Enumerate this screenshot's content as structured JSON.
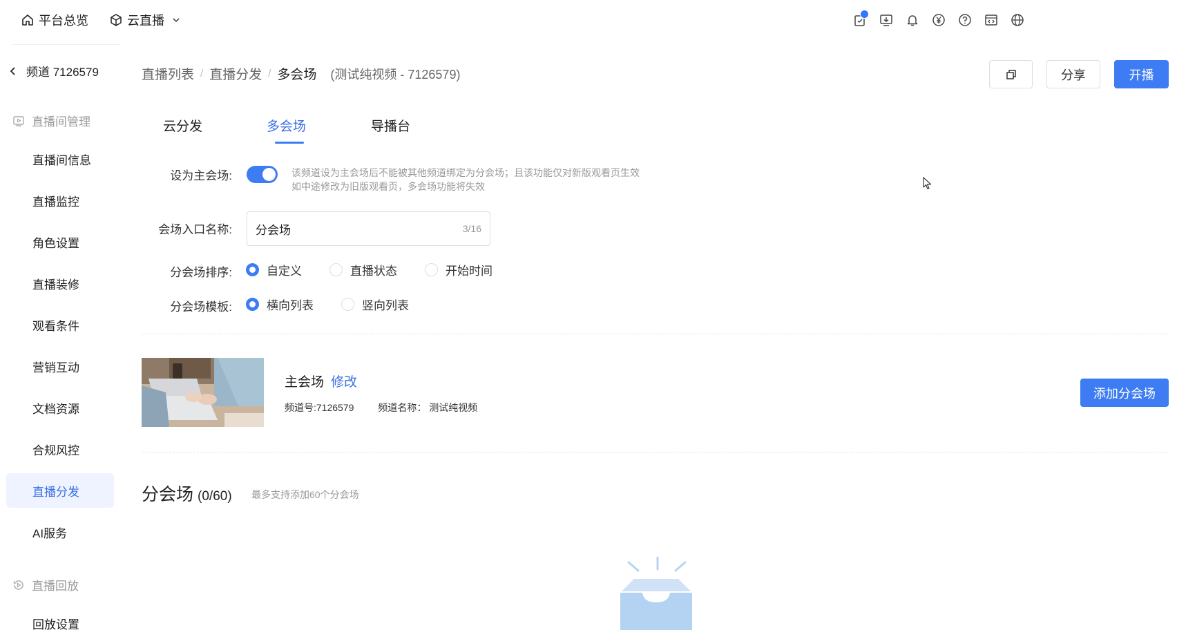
{
  "topbar": {
    "overview_label": "平台总览",
    "product_label": "云直播",
    "icons": [
      "task-check-icon",
      "download-icon",
      "bell-icon",
      "yuan-icon",
      "help-icon",
      "code-window-icon",
      "globe-icon"
    ]
  },
  "sidebar": {
    "channel_label": "频道 7126579",
    "group_room": "直播间管理",
    "items": [
      {
        "label": "直播间信息"
      },
      {
        "label": "直播监控"
      },
      {
        "label": "角色设置"
      },
      {
        "label": "直播装修"
      },
      {
        "label": "观看条件"
      },
      {
        "label": "营销互动"
      },
      {
        "label": "文档资源"
      },
      {
        "label": "合规风控"
      },
      {
        "label": "直播分发",
        "active": true
      },
      {
        "label": "AI服务"
      }
    ],
    "group_replay": "直播回放",
    "replay_items": [
      {
        "label": "回放设置"
      }
    ]
  },
  "header": {
    "breadcrumb": [
      "直播列表",
      "直播分发",
      "多会场"
    ],
    "separator": "/",
    "subtitle": "(测试纯视频 - 7126579)",
    "share_label": "分享",
    "start_label": "开播"
  },
  "tabs": [
    {
      "label": "云分发"
    },
    {
      "label": "多会场",
      "active": true
    },
    {
      "label": "导播台"
    }
  ],
  "form": {
    "main_venue_label": "设为主会场:",
    "main_venue_on": true,
    "hint_line1": "该频道设为主会场后不能被其他频道绑定为分会场；且该功能仅对新版观看页生效",
    "hint_line2": "如中途修改为旧版观看页，多会场功能将失效",
    "entry_name_label": "会场入口名称:",
    "entry_name_value": "分会场",
    "entry_name_count": "3/16",
    "sort_label": "分会场排序:",
    "sort_options": [
      "自定义",
      "直播状态",
      "开始时间"
    ],
    "sort_selected": "自定义",
    "template_label": "分会场模板:",
    "template_options": [
      "横向列表",
      "竖向列表"
    ],
    "template_selected": "横向列表"
  },
  "main_venue": {
    "title": "主会场",
    "edit_label": "修改",
    "channel_no": "频道号:7126579",
    "channel_name": "频道名称： 测试纯视频",
    "add_button": "添加分会场"
  },
  "sub_venues": {
    "title": "分会场",
    "count": "(0/60)",
    "note": "最多支持添加60个分会场"
  },
  "colors": {
    "primary": "#3d7cf2",
    "active_bg": "#eef3ff",
    "muted": "#999999"
  }
}
